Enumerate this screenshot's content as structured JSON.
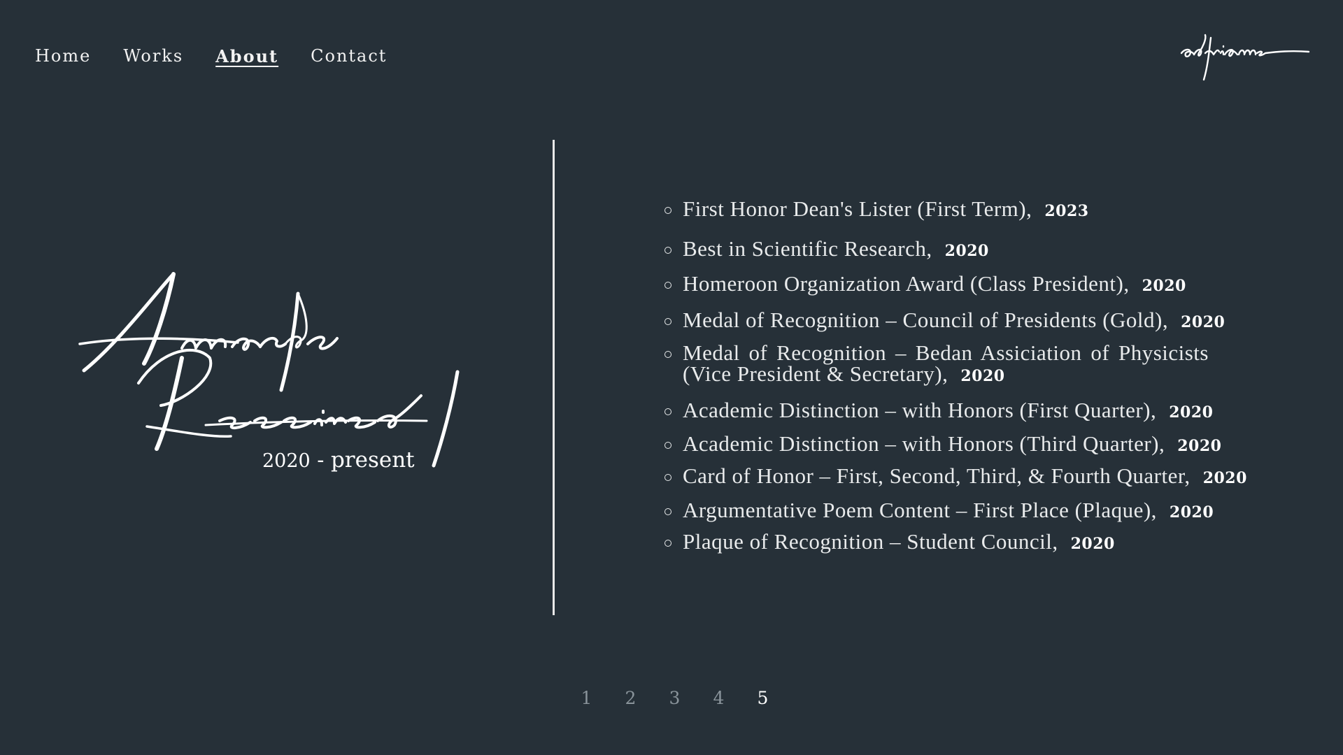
{
  "nav": {
    "items": [
      "Home",
      "Works",
      "About",
      "Contact"
    ],
    "active": "About"
  },
  "logo": {
    "text": "adrianne"
  },
  "section": {
    "title_line1": "Awards",
    "title_line2": "Received",
    "date_start": "2020",
    "date_separator": "-",
    "date_end": "present"
  },
  "awards": [
    {
      "title": "First Honor Dean's Lister (First Term),",
      "year": "2023"
    },
    {
      "title": "Best in Scientific Research,",
      "year": "2020"
    },
    {
      "title": "Homeroon Organization Award (Class President),",
      "year": "2020"
    },
    {
      "title": "Medal of Recognition – Council of Presidents (Gold),",
      "year": "2020"
    },
    {
      "title": "Medal of Recognition – Bedan Assiciation of Physicists (Vice President & Secretary),",
      "year": "2020"
    },
    {
      "title": "Academic Distinction – with Honors (First Quarter),",
      "year": "2020"
    },
    {
      "title": "Academic Distinction – with Honors (Third Quarter),",
      "year": "2020"
    },
    {
      "title": "Card of Honor – First, Second, Third, & Fourth Quarter,",
      "year": "2020"
    },
    {
      "title": "Argumentative Poem Content – First Place (Plaque),",
      "year": "2020"
    },
    {
      "title": "Plaque of Recognition – Student Council,",
      "year": "2020"
    }
  ],
  "pagination": {
    "pages": [
      "1",
      "2",
      "3",
      "4",
      "5"
    ],
    "current": "5"
  },
  "colors": {
    "background": "#263038",
    "text": "#f4f4f4",
    "inactive_page": "#8a949b"
  }
}
